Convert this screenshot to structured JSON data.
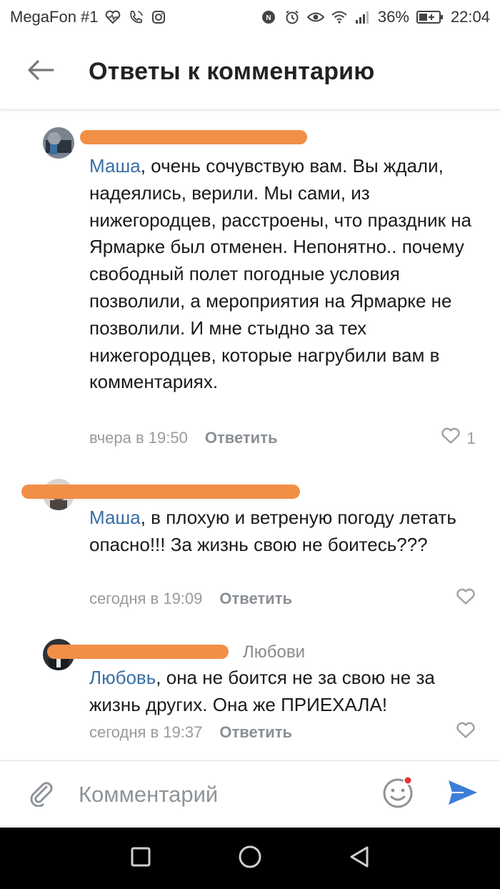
{
  "status_bar": {
    "carrier": "MegaFon #1",
    "battery": "36%",
    "time": "22:04"
  },
  "header": {
    "title": "Ответы к комментарию",
    "back_icon": "arrow-left-icon"
  },
  "comments": [
    {
      "author_visible": "",
      "mention": "Маша",
      "body": ", очень сочувствую вам. Вы ждали, надеялись, верили. Мы сами, из нижегородцев, расстроены, что праздник на Ярмарке был отменен. Непонятно.. почему свободный полет погодные условия позволили, а мероприятия на Ярмарке не позволили. И мне стыдно за тех нижегородцев, которые нагрубили вам в комментариях.",
      "time": "вчера в 19:50",
      "reply_label": "Ответить",
      "likes": "1"
    },
    {
      "author_visible": "",
      "mention": "Маша",
      "body": ", в плохую и ветреную погоду летать опасно!!! За жизнь свою не боитесь???",
      "time": "сегодня в 19:09",
      "reply_label": "Ответить",
      "likes": ""
    },
    {
      "author_visible": "",
      "reply_to": "Любови",
      "mention": "Любовь",
      "body": ", она не боится не за свою не за жизнь других. Она же ПРИЕХАЛА!",
      "time": "сегодня в 19:37",
      "reply_label": "Ответить",
      "likes": ""
    }
  ],
  "composer": {
    "placeholder": "Комментарий",
    "value": ""
  },
  "colors": {
    "mention": "#3a6ea5",
    "redaction": "#f28f47",
    "send": "#3d7fd6",
    "emoji_badge": "#e8343b"
  }
}
